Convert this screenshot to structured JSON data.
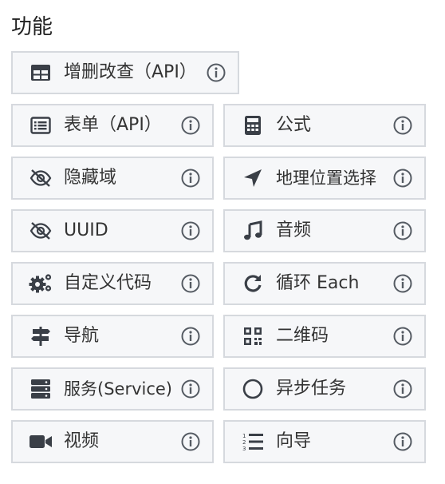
{
  "section": {
    "title": "功能"
  },
  "features": {
    "crud": {
      "label": "增删改查（API）",
      "icon": "table-grid-icon"
    },
    "form": {
      "label": "表单（API）",
      "icon": "list-form-icon"
    },
    "formula": {
      "label": "公式",
      "icon": "calculator-icon"
    },
    "hidden_field": {
      "label": "隐藏域",
      "icon": "eye-slash-icon"
    },
    "location": {
      "label": "地理位置选择",
      "icon": "location-arrow-icon"
    },
    "uuid": {
      "label": "UUID",
      "icon": "eye-slash-icon"
    },
    "audio": {
      "label": "音频",
      "icon": "music-note-icon"
    },
    "custom_code": {
      "label": "自定义代码",
      "icon": "gears-icon"
    },
    "loop_each": {
      "label": "循环 Each",
      "icon": "redo-icon"
    },
    "nav": {
      "label": "导航",
      "icon": "signpost-icon"
    },
    "qrcode": {
      "label": "二维码",
      "icon": "qrcode-icon"
    },
    "service": {
      "label": "服务(Service)",
      "icon": "server-icon"
    },
    "async_task": {
      "label": "异步任务",
      "icon": "circle-outline-icon"
    },
    "video": {
      "label": "视频",
      "icon": "video-camera-icon"
    },
    "wizard": {
      "label": "向导",
      "icon": "ordered-list-icon"
    }
  }
}
